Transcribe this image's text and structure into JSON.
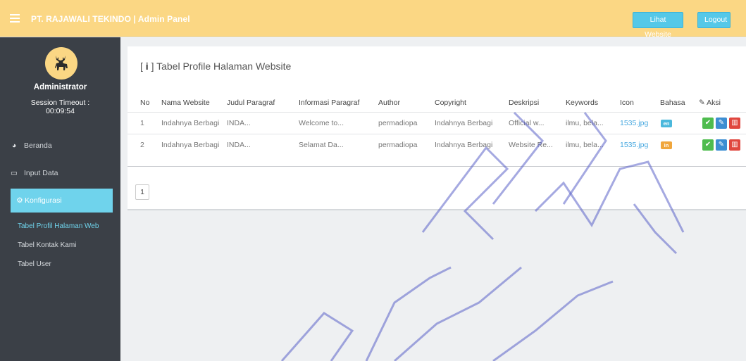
{
  "header": {
    "brand": "PT. RAJAWALI TEKINDO | Admin Panel",
    "view_site_label": "Lihat Website",
    "logout_label": "Logout"
  },
  "sidebar": {
    "user_role": "Administrator",
    "session_label": "Session Timeout :",
    "session_time": "00:09:54",
    "menu": [
      {
        "label": "Beranda",
        "icon": "dashboard-icon"
      },
      {
        "label": "Input Data",
        "icon": "monitor-icon"
      },
      {
        "label": "Konfigurasi",
        "icon": "gears-icon"
      }
    ],
    "submenu": [
      {
        "label": "Tabel Profil Halaman Web"
      },
      {
        "label": "Tabel Kontak Kami"
      },
      {
        "label": "Tabel User"
      }
    ]
  },
  "content": {
    "title_bracket_open": "[",
    "title_icon": "i",
    "title_bracket_close": "]",
    "title_text": "Tabel Profile Halaman Website",
    "columns": [
      "No",
      "Nama Website",
      "Judul Paragraf",
      "Informasi Paragraf",
      "Author",
      "Copyright",
      "Deskripsi",
      "Keywords",
      "Icon",
      "Bahasa",
      "Aksi"
    ],
    "rows": [
      {
        "no": "1",
        "nama": "Indahnya Berbagi",
        "judul": "INDA...",
        "info": "Welcome to...",
        "author": "permadiopa",
        "copyright": "Indahnya Berbagi",
        "deskripsi": "Official w...",
        "keywords": "ilmu, bela...",
        "icon": "1535.jpg",
        "bahasa": "en"
      },
      {
        "no": "2",
        "nama": "Indahnya Berbagi",
        "judul": "INDA...",
        "info": "Selamat Da...",
        "author": "permadiopa",
        "copyright": "Indahnya Berbagi",
        "deskripsi": "Website Re...",
        "keywords": "ilmu, bela...",
        "icon": "1535.jpg",
        "bahasa": "in"
      }
    ],
    "page": "1"
  },
  "colors": {
    "header_bg": "#fbd784",
    "sidebar_bg": "#3b4047",
    "accent": "#6fd3ec",
    "lang_en": "#4bb8dc",
    "lang_in": "#f0a63c",
    "approve": "#4ebc4e",
    "edit": "#3d8ed2",
    "delete": "#e0463e"
  }
}
